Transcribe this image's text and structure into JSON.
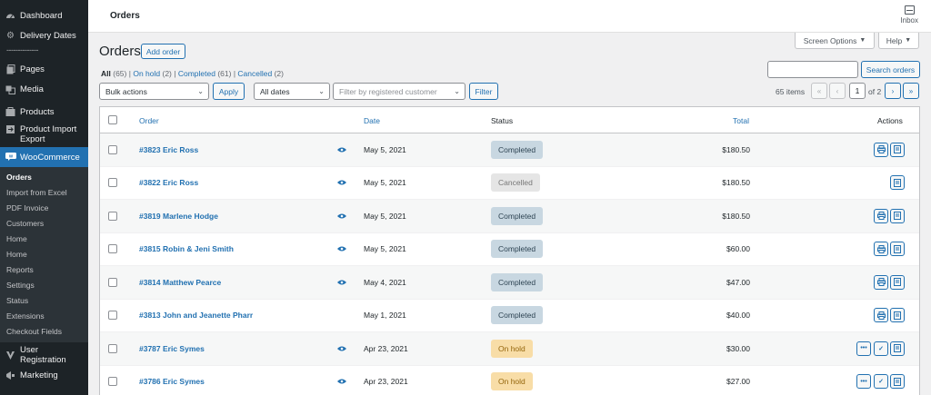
{
  "sidebar": {
    "items_top": [
      {
        "label": "Dashboard",
        "icon": "dashboard-icon"
      },
      {
        "label": "Delivery Dates",
        "icon": "gear-icon"
      }
    ],
    "separator": "--------------",
    "items_mid": [
      {
        "label": "Pages",
        "icon": "pages-icon"
      },
      {
        "label": "Media",
        "icon": "media-icon"
      },
      {
        "label": "Products",
        "icon": "products-icon"
      },
      {
        "label": "Product Import Export",
        "icon": "import-export-icon"
      }
    ],
    "woocommerce": {
      "label": "WooCommerce",
      "icon": "woo-icon"
    },
    "submenu": [
      "Orders",
      "Import from Excel",
      "PDF Invoice",
      "Customers",
      "Home",
      "Home",
      "Reports",
      "Settings",
      "Status",
      "Extensions",
      "Checkout Fields"
    ],
    "items_bottom": [
      {
        "label": "User Registration",
        "icon": "user-registration-icon"
      },
      {
        "label": "Marketing",
        "icon": "megaphone-icon"
      }
    ]
  },
  "topbar": {
    "title": "Orders",
    "inbox": "Inbox"
  },
  "screen_options": "Screen Options",
  "help": "Help",
  "page": {
    "title": "Orders",
    "add_order": "Add order"
  },
  "filters": {
    "all": "All",
    "all_count": "(65)",
    "on_hold": "On hold",
    "on_hold_count": "(2)",
    "completed": "Completed",
    "completed_count": "(61)",
    "cancelled": "Cancelled",
    "cancelled_count": "(2)"
  },
  "bulk_actions": "Bulk actions",
  "apply": "Apply",
  "dates": "All dates",
  "customer_placeholder": "Filter by registered customer",
  "filter": "Filter",
  "search_button": "Search orders",
  "pagination": {
    "count": "65 items",
    "first": "«",
    "prev": "‹",
    "current": "1",
    "of": "of 2",
    "next": "›",
    "last": "»"
  },
  "columns": {
    "order": "Order",
    "date": "Date",
    "status": "Status",
    "total": "Total",
    "actions": "Actions"
  },
  "orders": [
    {
      "order": "#3823 Eric Ross",
      "date": "May 5, 2021",
      "status": "Completed",
      "status_key": "completed",
      "total": "$180.50"
    },
    {
      "order": "#3822 Eric Ross",
      "date": "May 5, 2021",
      "status": "Cancelled",
      "status_key": "cancelled",
      "total": "$180.50"
    },
    {
      "order": "#3819 Marlene Hodge",
      "date": "May 5, 2021",
      "status": "Completed",
      "status_key": "completed",
      "total": "$180.50"
    },
    {
      "order": "#3815 Robin & Jeni Smith",
      "date": "May 5, 2021",
      "status": "Completed",
      "status_key": "completed",
      "total": "$60.00"
    },
    {
      "order": "#3814 Matthew Pearce",
      "date": "May 4, 2021",
      "status": "Completed",
      "status_key": "completed",
      "total": "$47.00"
    },
    {
      "order": "#3813 John and Jeanette Pharr",
      "date": "May 1, 2021",
      "status": "Completed",
      "status_key": "completed",
      "total": "$40.00"
    },
    {
      "order": "#3787 Eric Symes",
      "date": "Apr 23, 2021",
      "status": "On hold",
      "status_key": "on-hold",
      "total": "$30.00"
    },
    {
      "order": "#3786 Eric Symes",
      "date": "Apr 23, 2021",
      "status": "On hold",
      "status_key": "on-hold",
      "total": "$27.00"
    }
  ]
}
